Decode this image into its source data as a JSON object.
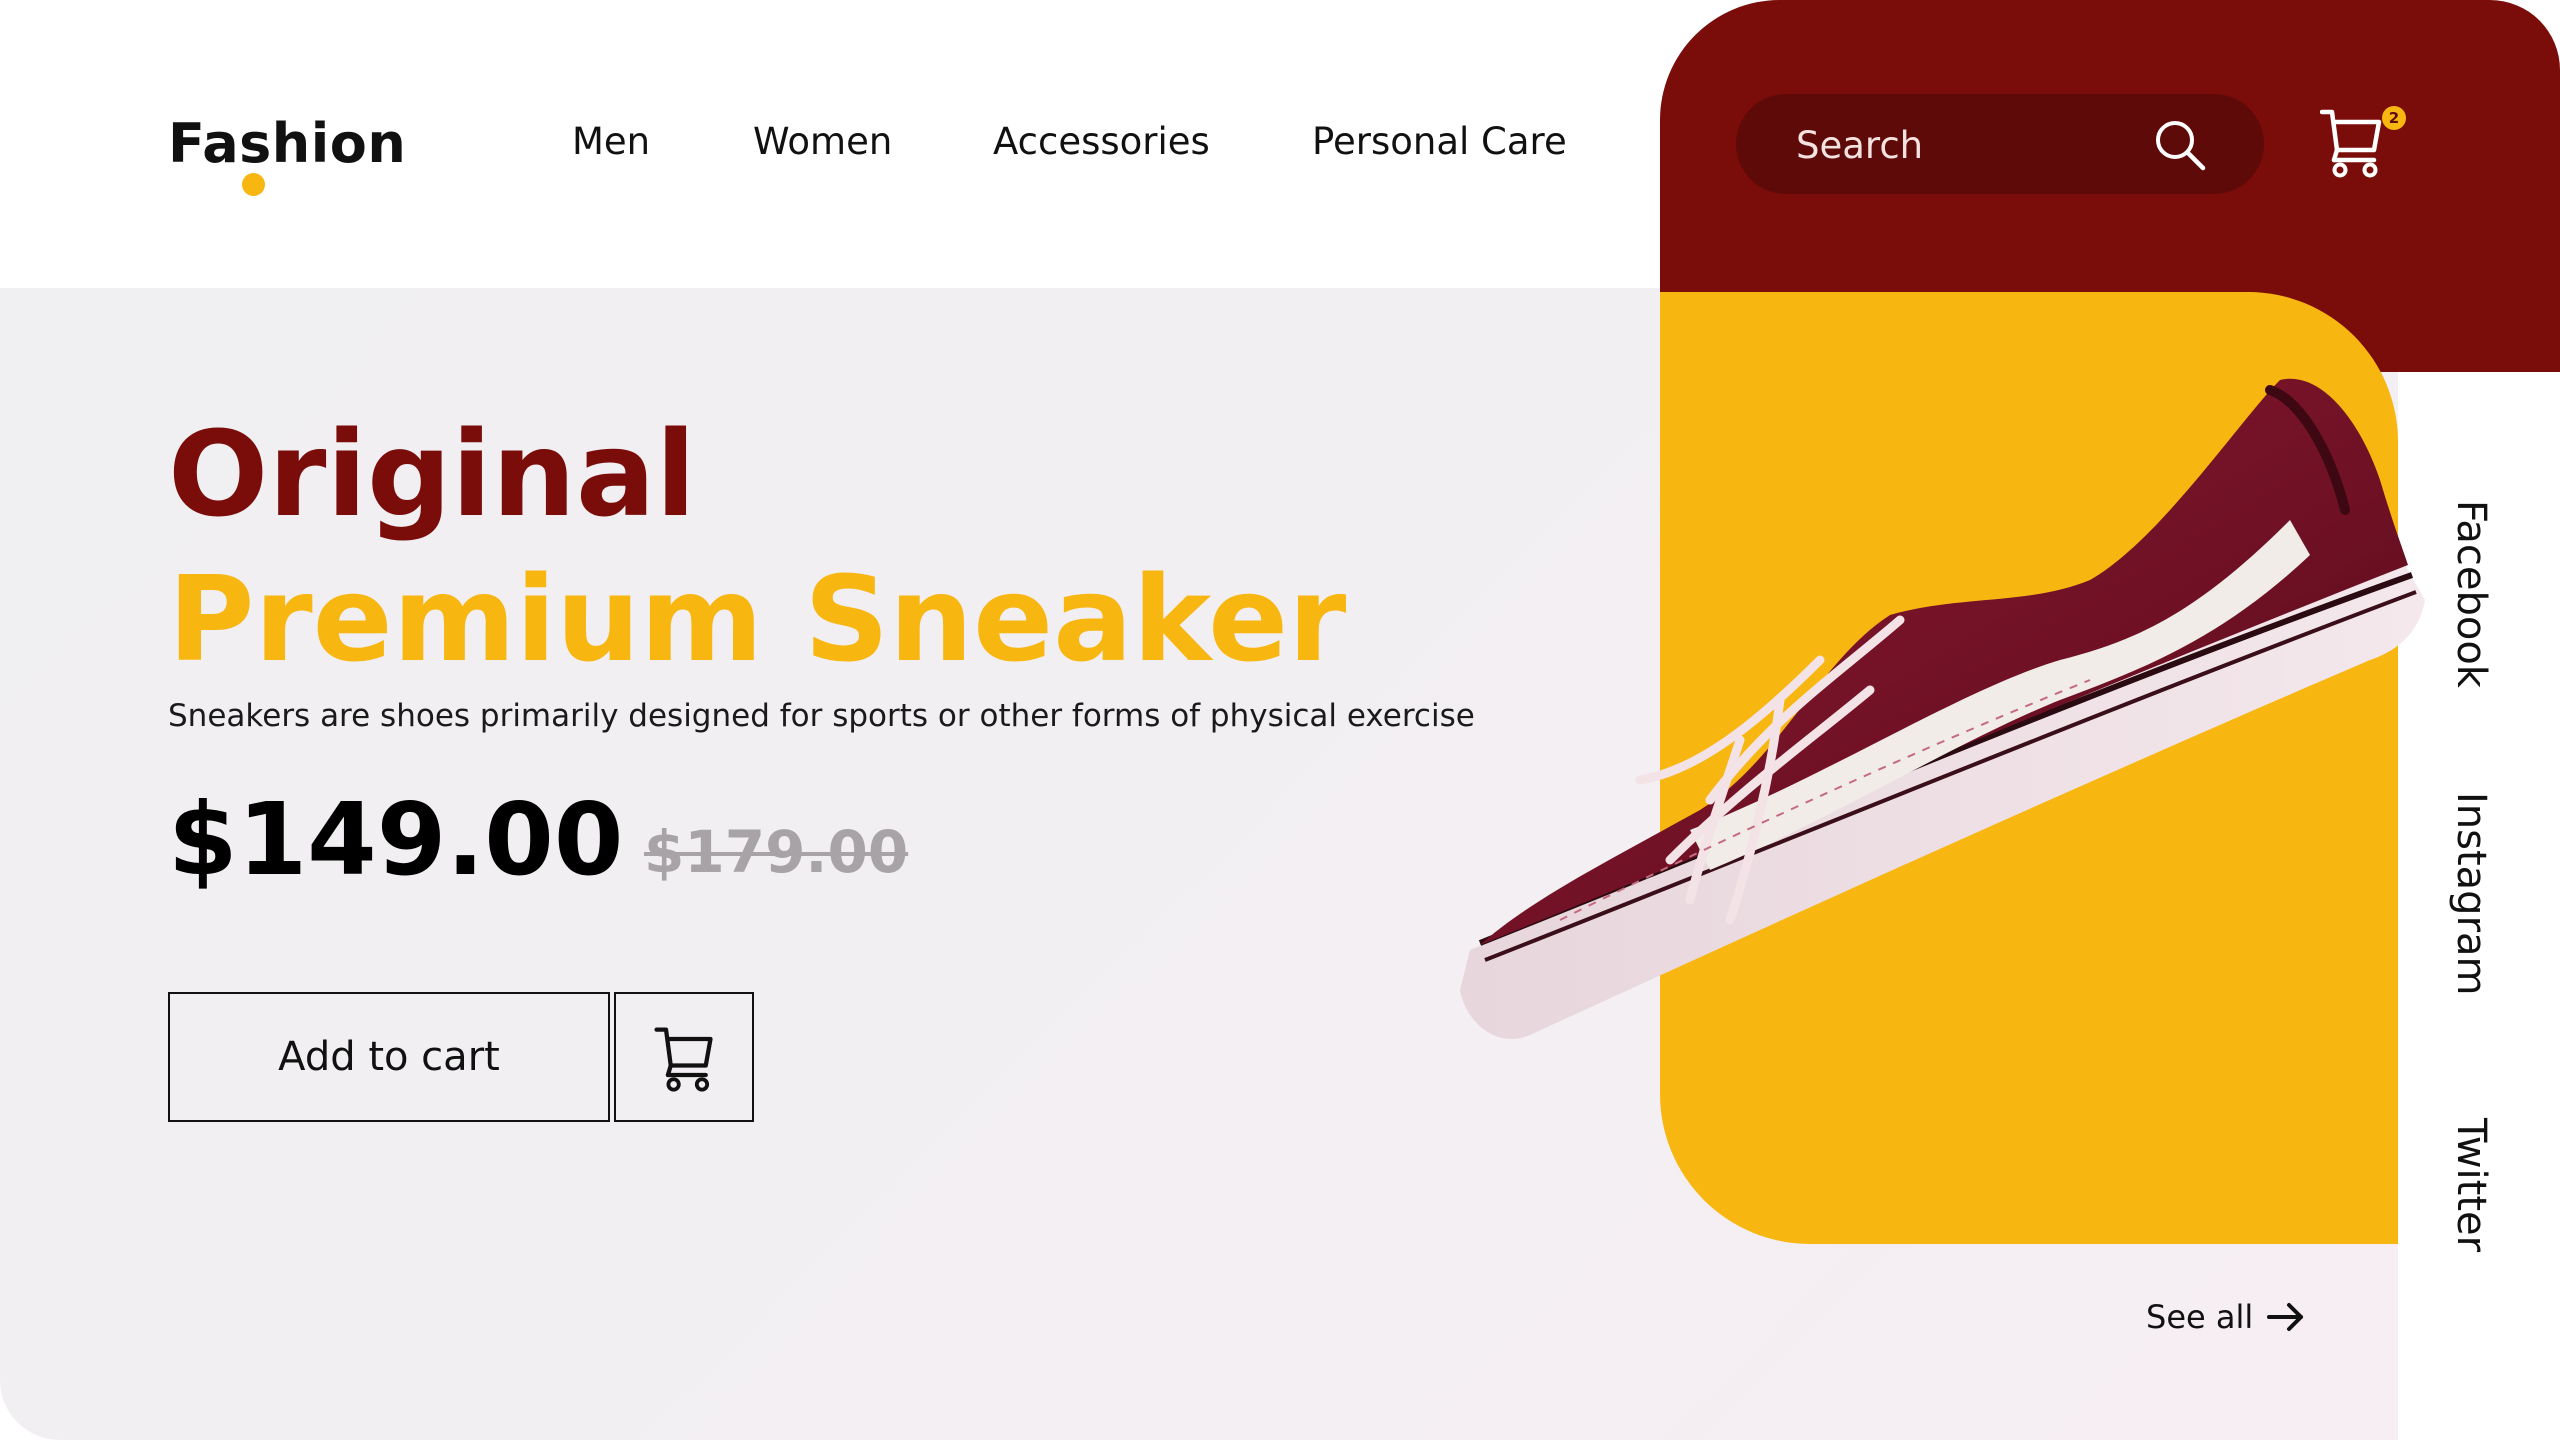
{
  "brand": {
    "name": "Fashion"
  },
  "nav": {
    "items": [
      "Men",
      "Women",
      "Accessories",
      "Personal Care"
    ]
  },
  "search": {
    "placeholder": "Search"
  },
  "cart": {
    "count": "2"
  },
  "hero": {
    "title_line1": "Original",
    "title_line2": "Premium Sneaker",
    "description": "Sneakers are shoes primarily designed for sports or other forms of physical exercise",
    "price": "$149.00",
    "old_price": "$179.00",
    "add_to_cart_label": "Add to cart"
  },
  "social": {
    "items": [
      "Facebook",
      "Instagram",
      "Twitter"
    ]
  },
  "see_all": {
    "label": "See all"
  },
  "colors": {
    "maroon": "#7a0d0a",
    "dark_maroon": "#5d0a08",
    "yellow": "#f8b611",
    "background": "#f0eff1"
  },
  "icons": [
    "search-icon",
    "cart-icon",
    "arrow-right-icon"
  ]
}
